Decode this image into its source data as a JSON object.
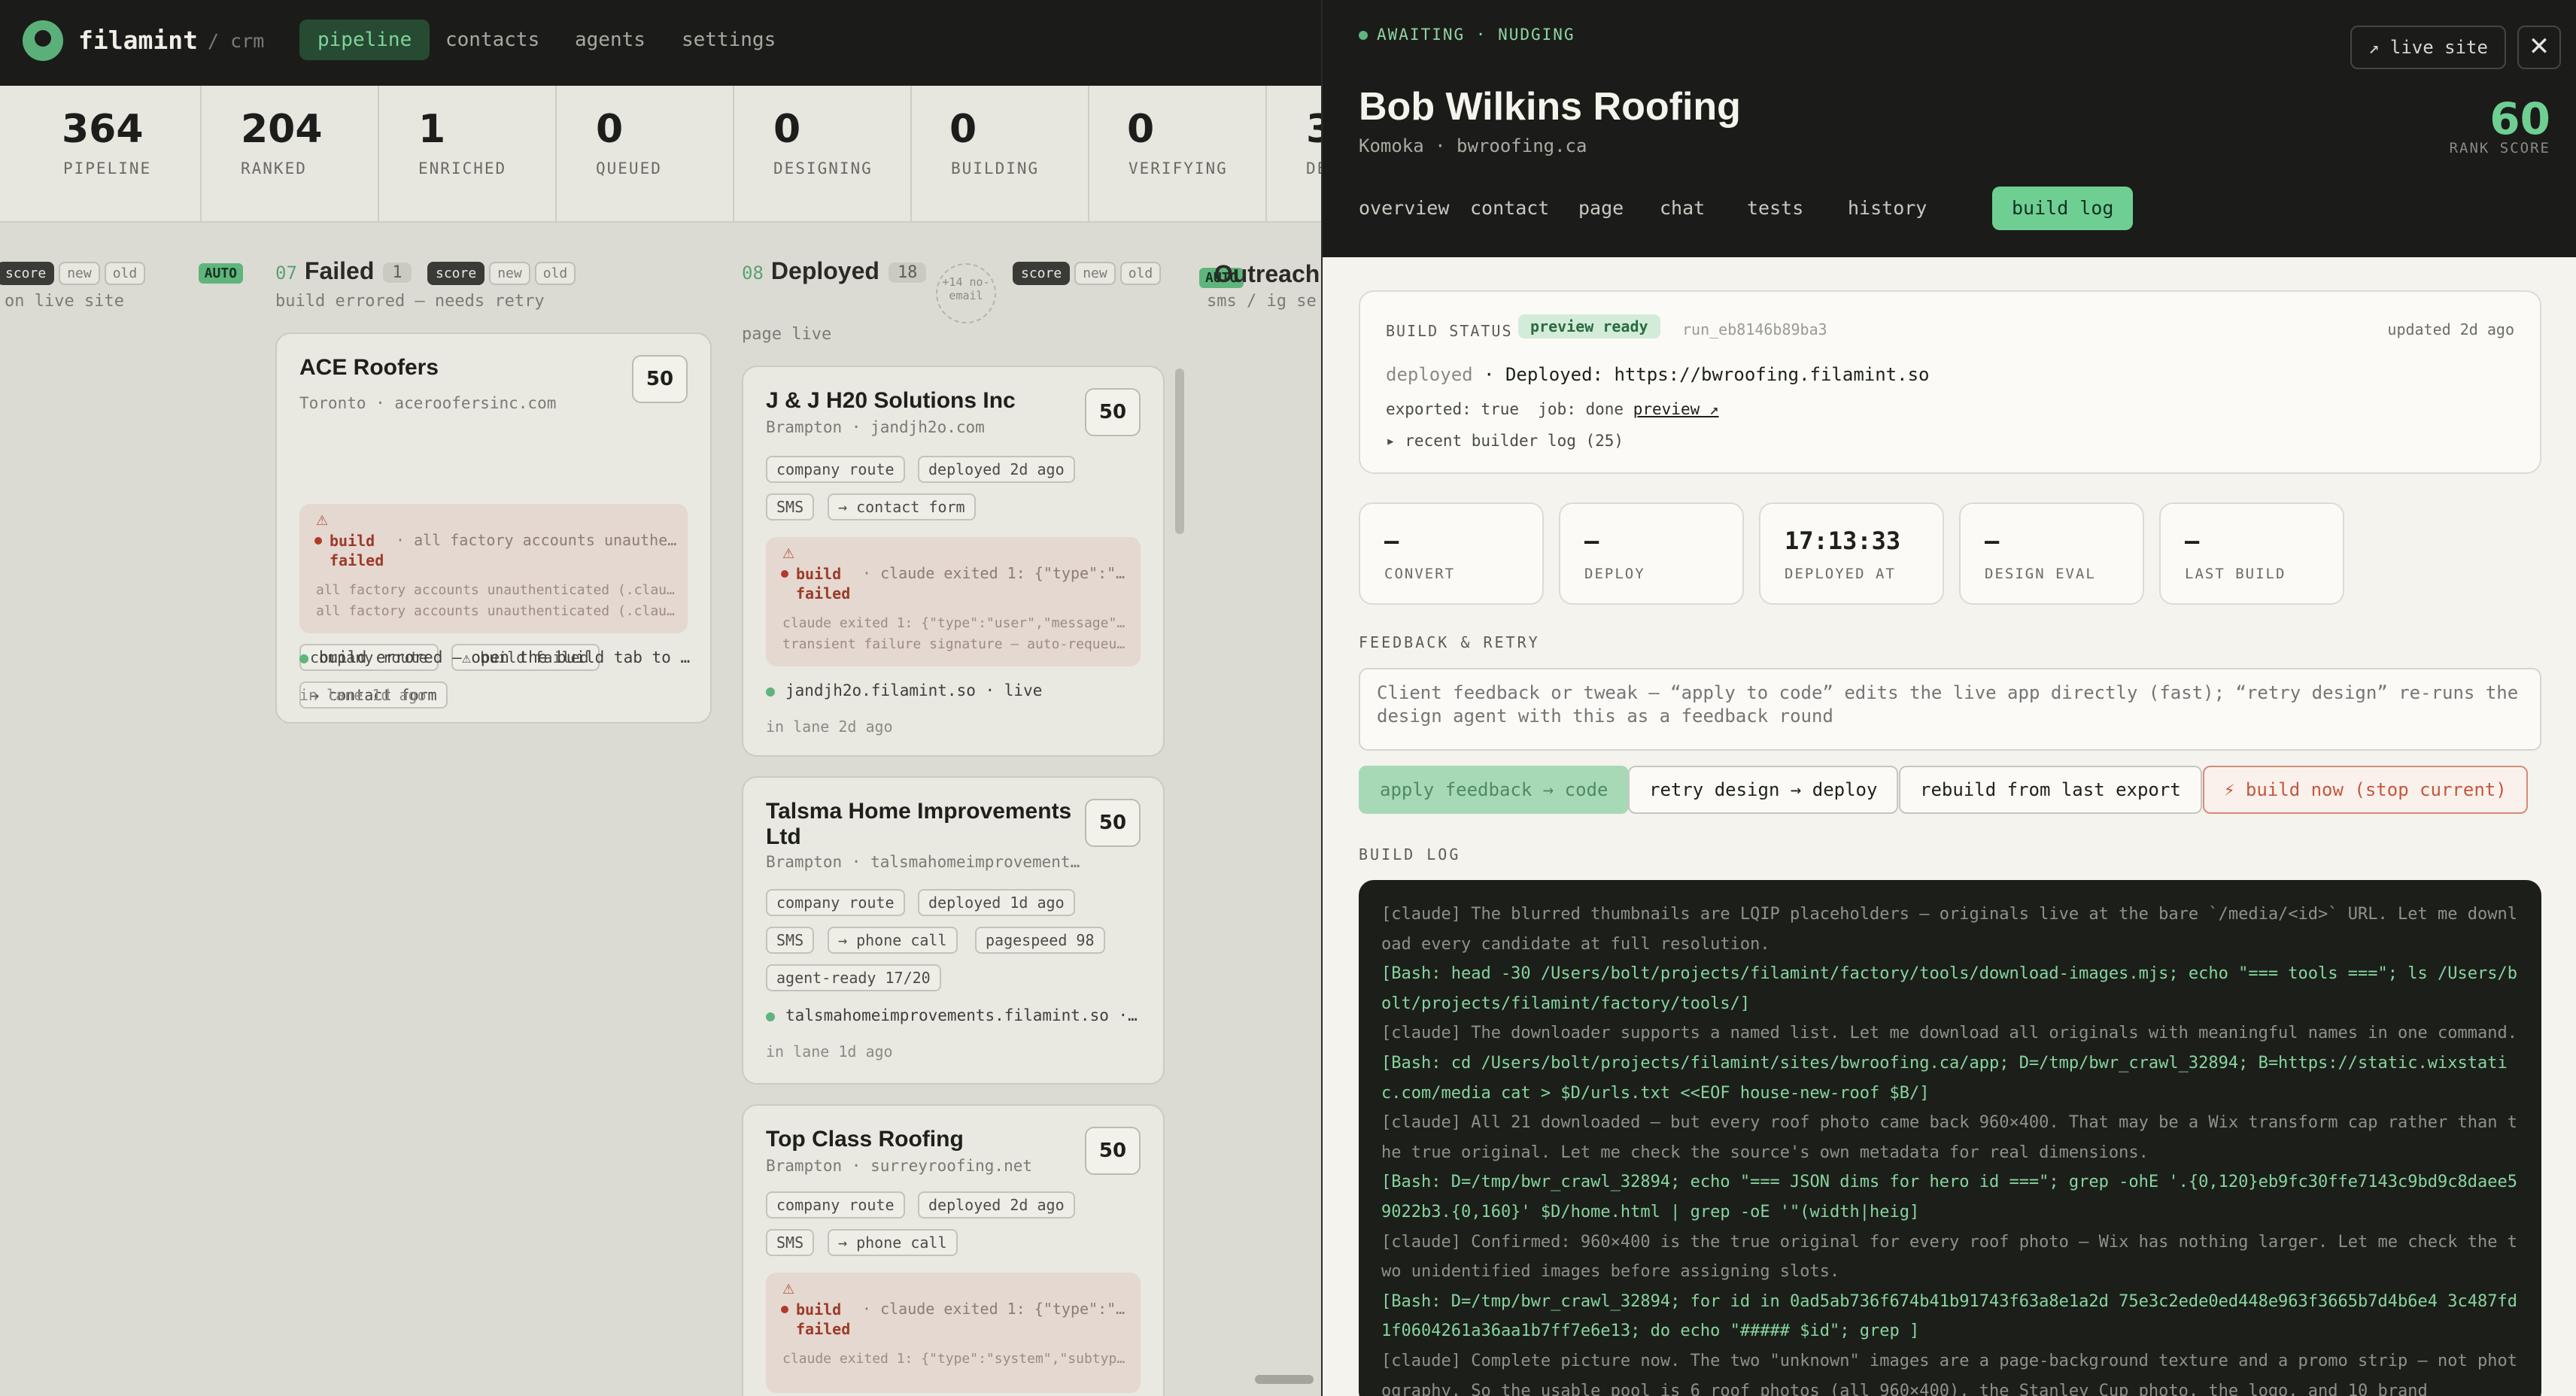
{
  "app": {
    "brand": "filamint",
    "crumb": "/ crm"
  },
  "nav": [
    {
      "label": "pipeline",
      "active": true
    },
    {
      "label": "contacts"
    },
    {
      "label": "agents"
    },
    {
      "label": "settings"
    }
  ],
  "stats": [
    {
      "value": "364",
      "label": "PIPELINE"
    },
    {
      "value": "204",
      "label": "RANKED"
    },
    {
      "value": "1",
      "label": "ENRICHED"
    },
    {
      "value": "0",
      "label": "QUEUED"
    },
    {
      "value": "0",
      "label": "DESIGNING"
    },
    {
      "value": "0",
      "label": "BUILDING"
    },
    {
      "value": "0",
      "label": "VERIFYING"
    },
    {
      "value": "3",
      "label": "DE"
    }
  ],
  "lanes": {
    "prev": {
      "chips": [
        "score",
        "new",
        "old"
      ],
      "auto": "AUTO",
      "sub": "on live site"
    },
    "failed": {
      "num": "07",
      "title": "Failed",
      "count": "1",
      "chips": [
        "score",
        "new",
        "old"
      ],
      "sub": "build errored — needs retry",
      "cards": [
        {
          "name": "ACE Roofers",
          "location": "Toronto · aceroofersinc.com",
          "score": "50",
          "tags": [
            "company route",
            "⚠ build failed",
            "→ contact form"
          ],
          "err": {
            "label": "build failed",
            "msg": "· all factory accounts unauthenticated",
            "l1": "all factory accounts unauthenticated (.claude/...)",
            "l2": "all factory accounts unauthenticated (.claude/...)"
          },
          "status": "build errored — open the build tab to retry",
          "foot": "in lane 1d ago"
        }
      ]
    },
    "deployed": {
      "num": "08",
      "title": "Deployed",
      "count": "18",
      "more": "+14 no-email",
      "chips": [
        "score",
        "new",
        "old"
      ],
      "sub": "page live",
      "cards": [
        {
          "name": "J & J H20 Solutions Inc",
          "location": "Brampton · jandjh2o.com",
          "score": "50",
          "tags": [
            "company route",
            "deployed 2d ago",
            "SMS",
            "→ contact form"
          ],
          "err": {
            "label": "build failed",
            "msg": "· claude exited 1: {\"type\":\"user\"",
            "l1": "claude exited 1: {\"type\":\"user\",\"message\":{...",
            "l2": "transient failure signature — auto-requeued"
          },
          "status": "jandjh2o.filamint.so · live",
          "foot": "in lane 2d ago"
        },
        {
          "name": "Talsma Home Improvements Ltd",
          "location": "Brampton · talsmahomeimprovements.com",
          "score": "50",
          "tags": [
            "company route",
            "deployed 1d ago",
            "SMS",
            "→ phone call",
            "pagespeed 98",
            "agent-ready 17/20"
          ],
          "status": "talsmahomeimprovements.filamint.so · live",
          "foot": "in lane 1d ago"
        },
        {
          "name": "Top Class Roofing",
          "location": "Brampton · surreyroofing.net",
          "score": "50",
          "tags": [
            "company route",
            "deployed 2d ago",
            "SMS",
            "→ phone call"
          ],
          "err": {
            "label": "build failed",
            "msg": "· claude exited 1: {\"type\":\"system\"",
            "l1": "claude exited 1: {\"type\":\"system\",\"subtype\"..."
          }
        }
      ]
    },
    "outreach": {
      "auto": "AUTO",
      "title": "Outreach",
      "sub": "sms / ig se"
    }
  },
  "drawer": {
    "status": "AWAITING · NUDGING",
    "live_site": "↗ live site",
    "close": "✕",
    "name": "Bob Wilkins Roofing",
    "location": "Komoka · bwroofing.ca",
    "rank_score": "60",
    "rank_label": "RANK SCORE",
    "tabs": [
      "overview",
      "contact",
      "page",
      "chat",
      "tests",
      "history",
      "build log"
    ],
    "active_tab": "build log",
    "build": {
      "label": "BUILD STATUS",
      "state": "preview ready",
      "run_id": "run_eb8146b89ba3",
      "updated": "updated 2d ago",
      "deployed_prefix": "deployed",
      "deployed_text": "· Deployed: https://bwroofing.filamint.so",
      "exported": "exported: true  job: done",
      "preview": "preview ↗",
      "recent": "▸ recent builder log (25)"
    },
    "metrics": [
      {
        "value": "–",
        "label": "CONVERT"
      },
      {
        "value": "–",
        "label": "DEPLOY"
      },
      {
        "value": "17:13:33",
        "label": "DEPLOYED AT"
      },
      {
        "value": "–",
        "label": "DESIGN EVAL"
      },
      {
        "value": "–",
        "label": "LAST BUILD"
      }
    ],
    "feedback_label": "FEEDBACK & RETRY",
    "feedback_placeholder": "Client feedback or tweak — “apply to code” edits the live app directly (fast); “retry design” re-runs the design agent with this as a feedback round",
    "actions": {
      "apply": "apply feedback → code",
      "retry": "retry design → deploy",
      "rebuild": "rebuild from last export",
      "now": "⚡ build now (stop current)"
    },
    "log_label": "BUILD LOG",
    "log": [
      {
        "kind": "c",
        "text": "[claude] The blurred thumbnails are LQIP placeholders — originals live at the bare `/media/<id>` URL. Let me download every candidate at full resolution."
      },
      {
        "kind": "b",
        "text": "[Bash: head -30 /Users/bolt/projects/filamint/factory/tools/download-images.mjs; echo \"=== tools ===\"; ls /Users/bolt/projects/filamint/factory/tools/]"
      },
      {
        "kind": "c",
        "text": "[claude] The downloader supports a named list. Let me download all originals with meaningful names in one command."
      },
      {
        "kind": "b",
        "text": "[Bash: cd /Users/bolt/projects/filamint/sites/bwroofing.ca/app; D=/tmp/bwr_crawl_32894; B=https://static.wixstatic.com/media cat > $D/urls.txt <<EOF house-new-roof $B/]"
      },
      {
        "kind": "c",
        "text": "[claude] All 21 downloaded — but every roof photo came back 960×400. That may be a Wix transform cap rather than the true original. Let me check the source's own metadata for real dimensions."
      },
      {
        "kind": "b",
        "text": "[Bash: D=/tmp/bwr_crawl_32894; echo \"=== JSON dims for hero id ===\"; grep -ohE '.{0,120}eb9fc30ffe7143c9bd9c8daee59022b3.{0,160}' $D/home.html | grep -oE '\"(width|heig]"
      },
      {
        "kind": "c",
        "text": "[claude] Confirmed: 960×400 is the true original for every roof photo — Wix has nothing larger. Let me check the two unidentified images before assigning slots."
      },
      {
        "kind": "b",
        "text": "[Bash: D=/tmp/bwr_crawl_32894; for id in 0ad5ab736f674b41b91743f63a8e1a2d 75e3c2ede0ed448e963f3665b7d4b6e4 3c487fd1f0604261a36aa1b7ff7e6e13; do echo \"##### $id\"; grep ]"
      },
      {
        "kind": "c",
        "text": "[claude] Complete picture now. The two \"unknown\" images are a page-background texture and a promo strip — not photography. So the usable pool is 6 roof photos (all 960×400), the Stanley Cup photo, the logo, and 10 brand"
      }
    ]
  }
}
